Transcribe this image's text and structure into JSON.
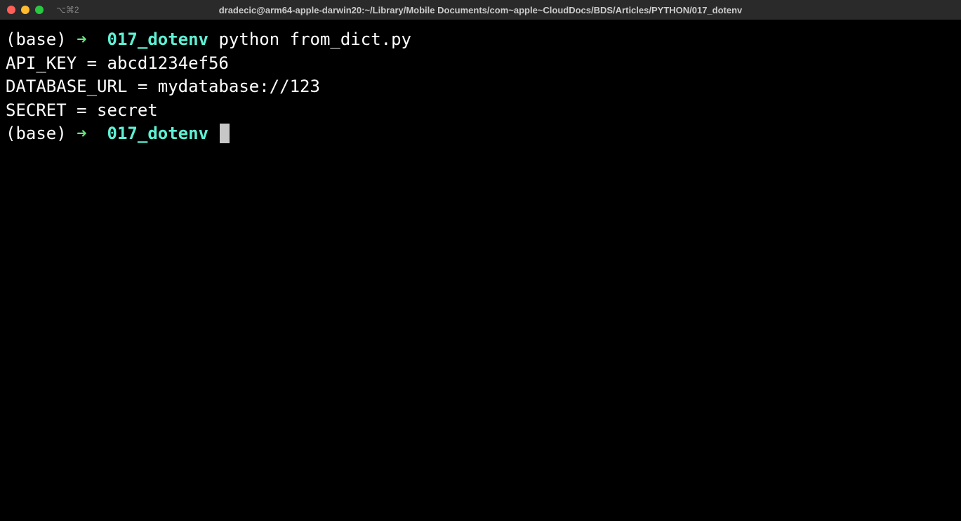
{
  "titlebar": {
    "tab_indicator": "⌥⌘2",
    "title": "dradecic@arm64-apple-darwin20:~/Library/Mobile Documents/com~apple~CloudDocs/BDS/Articles/PYTHON/017_dotenv"
  },
  "prompt": {
    "env": "(base)",
    "arrow": "➜",
    "dir": "017_dotenv"
  },
  "lines": [
    {
      "type": "prompt",
      "command": "python from_dict.py"
    },
    {
      "type": "output",
      "text": "API_KEY = abcd1234ef56"
    },
    {
      "type": "output",
      "text": "DATABASE_URL = mydatabase://123"
    },
    {
      "type": "output",
      "text": "SECRET = secret"
    },
    {
      "type": "prompt",
      "command": ""
    }
  ]
}
